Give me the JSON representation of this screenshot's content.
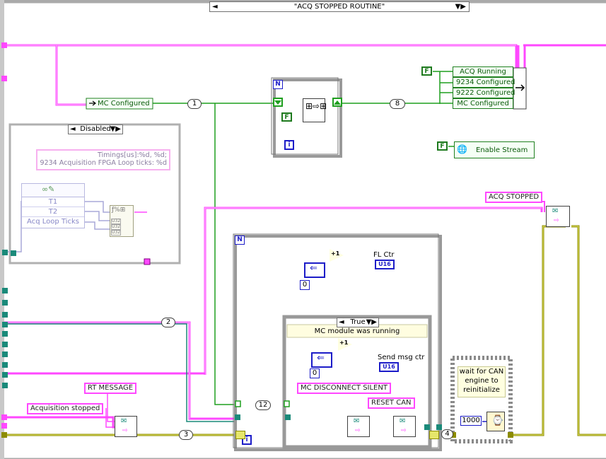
{
  "case_selector": {
    "value": "\"ACQ STOPPED ROUTINE\""
  },
  "bundle_labels": [
    "ACQ Running",
    "9234 Configured",
    "9222 Configured",
    "MC Configured"
  ],
  "unbundle": {
    "mc_configured": "MC Configured"
  },
  "enable_stream": "Enable Stream",
  "bool_false_label": "F",
  "disabled_structure": {
    "selector": "Disabled",
    "format_string": "Timings[us]:%d, %d;\n9234 Acquisition FPGA Loop ticks: %d",
    "cluster_items": [
      "T1",
      "T2",
      "Acq Loop Ticks"
    ],
    "type_tag": "U32"
  },
  "loop_counts": {
    "n_label": "N",
    "i_label": "i",
    "top_count": "1",
    "top_loop_count": "8",
    "mid_count": "2",
    "bottom_count": "3",
    "inner_count": "12",
    "right_count": "4"
  },
  "acq_stopped": "ACQ STOPPED",
  "rt_message": "RT MESSAGE",
  "acquisition_stopped": "Acquisition stopped",
  "mc_disconnect_silent": "MC DISCONNECT SILENT",
  "reset_can": "RESET CAN",
  "fl_ctr": "FL Ctr",
  "send_msg_ctr": "Send msg ctr",
  "u16": "U16",
  "zero_const": "0",
  "increment": "+1",
  "inner_case": {
    "selector": "True",
    "label": "MC module was running"
  },
  "wait": {
    "comment": "wait for CAN engine to reinitialize",
    "ms": "1000"
  },
  "colors": {
    "pink_wire": "#ff48ff",
    "green_wire": "#1f9f1f",
    "blue_wire": "#1c1cc8",
    "olive_wire": "#8c8c00",
    "teal_term": "#1a8a7a",
    "frame_gray": "#aaaaaa"
  }
}
